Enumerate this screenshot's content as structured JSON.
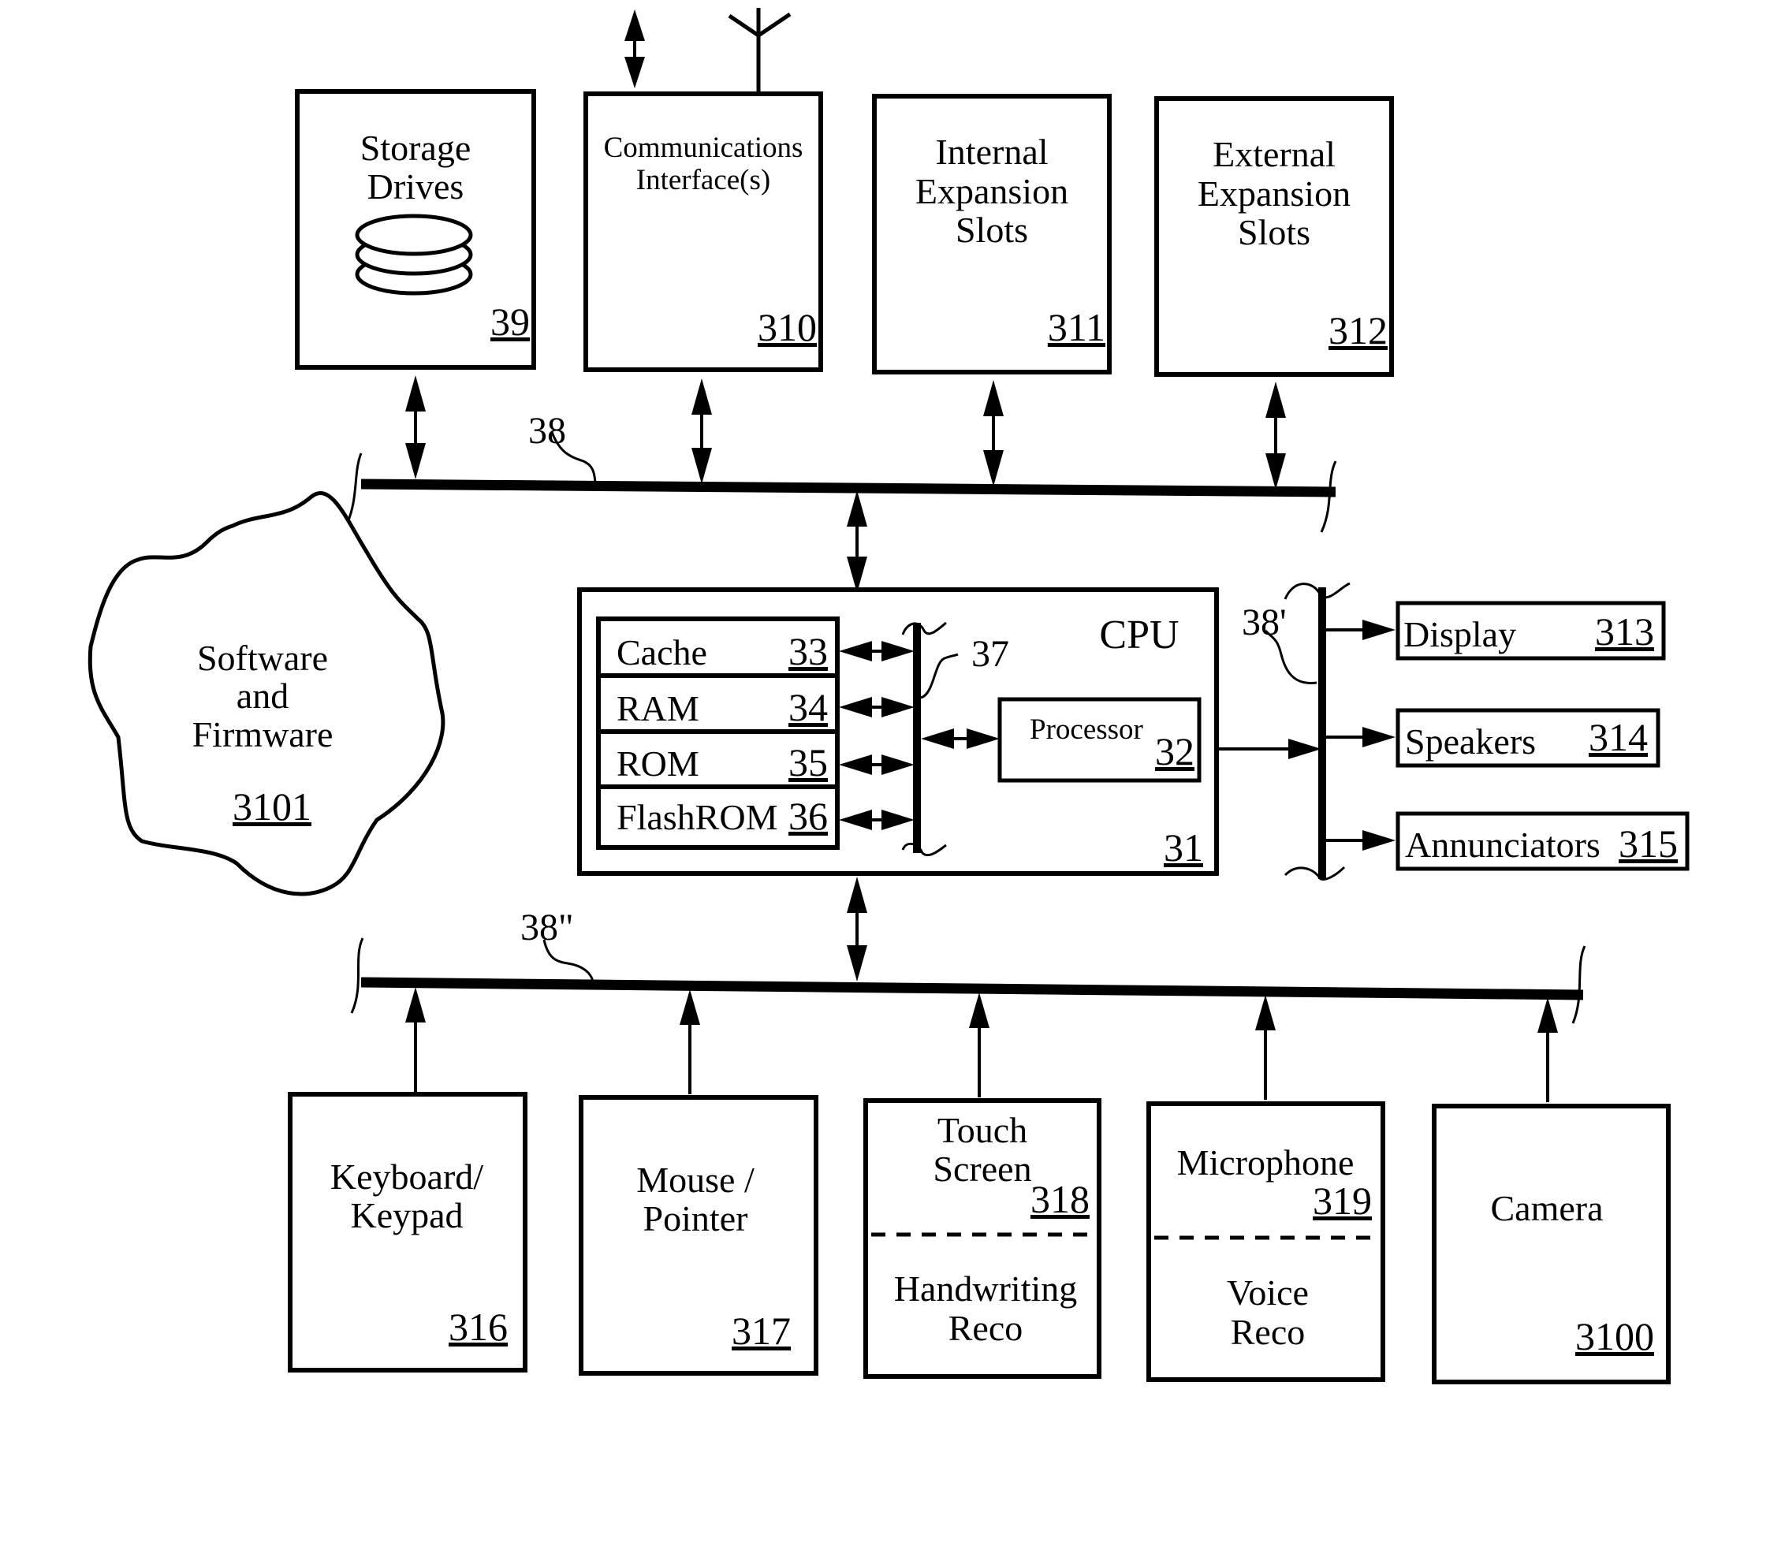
{
  "diagram": {
    "type": "block-diagram",
    "subject": "Computer system architecture with buses"
  },
  "top_blocks": [
    {
      "id": "storage",
      "lines": [
        "Storage",
        "Drives"
      ],
      "ref": "39",
      "icon": "disk-stack-icon"
    },
    {
      "id": "comms",
      "lines": [
        "Communications",
        "Interface(s)"
      ],
      "ref": "310",
      "icon": "antenna-icon"
    },
    {
      "id": "internal",
      "lines": [
        "Internal",
        "Expansion",
        "Slots"
      ],
      "ref": "311"
    },
    {
      "id": "external",
      "lines": [
        "External",
        "Expansion",
        "Slots"
      ],
      "ref": "312"
    }
  ],
  "buses": {
    "main": "38",
    "output": "38'",
    "input": "38\"",
    "internal": "37"
  },
  "software": {
    "lines": [
      "Software",
      "and",
      "Firmware"
    ],
    "ref": "3101"
  },
  "cpu": {
    "title": "CPU",
    "ref": "31",
    "memory": [
      {
        "label": "Cache",
        "ref": "33"
      },
      {
        "label": "RAM",
        "ref": "34"
      },
      {
        "label": "ROM",
        "ref": "35"
      },
      {
        "label": "FlashROM",
        "ref": "36"
      }
    ],
    "processor": {
      "label": "Processor",
      "ref": "32"
    }
  },
  "outputs": [
    {
      "label": "Display",
      "ref": "313"
    },
    {
      "label": "Speakers",
      "ref": "314"
    },
    {
      "label": "Annunciators",
      "ref": "315"
    }
  ],
  "inputs": [
    {
      "id": "keyboard",
      "lines": [
        "Keyboard/",
        "Keypad"
      ],
      "ref": "316"
    },
    {
      "id": "mouse",
      "lines": [
        "Mouse /",
        "Pointer"
      ],
      "ref": "317"
    },
    {
      "id": "touch",
      "lines": [
        "Touch",
        "Screen"
      ],
      "ref": "318",
      "sub": [
        "Handwriting",
        "Reco"
      ]
    },
    {
      "id": "mic",
      "lines": [
        "Microphone"
      ],
      "ref": "319",
      "sub": [
        "Voice",
        "Reco"
      ]
    },
    {
      "id": "camera",
      "lines": [
        "Camera"
      ],
      "ref": "3100"
    }
  ]
}
